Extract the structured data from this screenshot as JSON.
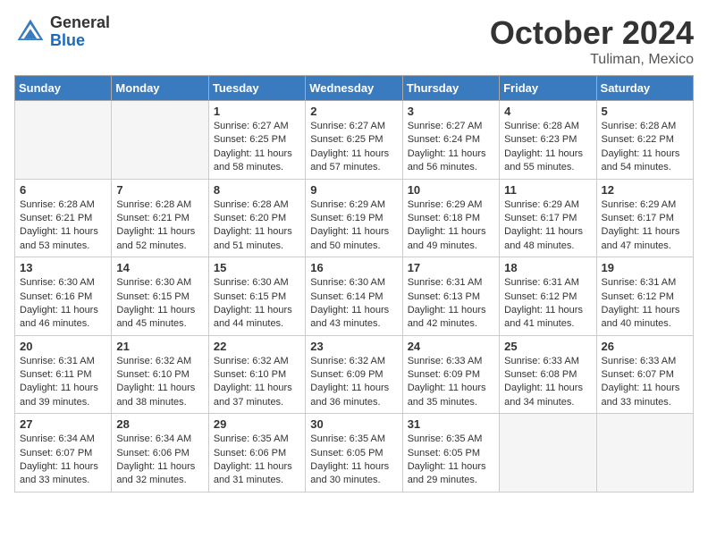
{
  "header": {
    "logo_general": "General",
    "logo_blue": "Blue",
    "month_title": "October 2024",
    "location": "Tuliman, Mexico"
  },
  "weekdays": [
    "Sunday",
    "Monday",
    "Tuesday",
    "Wednesday",
    "Thursday",
    "Friday",
    "Saturday"
  ],
  "weeks": [
    [
      {
        "day": "",
        "empty": true
      },
      {
        "day": "",
        "empty": true
      },
      {
        "day": "1",
        "sunrise": "6:27 AM",
        "sunset": "6:25 PM",
        "daylight": "Daylight: 11 hours and 58 minutes."
      },
      {
        "day": "2",
        "sunrise": "6:27 AM",
        "sunset": "6:25 PM",
        "daylight": "Daylight: 11 hours and 57 minutes."
      },
      {
        "day": "3",
        "sunrise": "6:27 AM",
        "sunset": "6:24 PM",
        "daylight": "Daylight: 11 hours and 56 minutes."
      },
      {
        "day": "4",
        "sunrise": "6:28 AM",
        "sunset": "6:23 PM",
        "daylight": "Daylight: 11 hours and 55 minutes."
      },
      {
        "day": "5",
        "sunrise": "6:28 AM",
        "sunset": "6:22 PM",
        "daylight": "Daylight: 11 hours and 54 minutes."
      }
    ],
    [
      {
        "day": "6",
        "sunrise": "6:28 AM",
        "sunset": "6:21 PM",
        "daylight": "Daylight: 11 hours and 53 minutes."
      },
      {
        "day": "7",
        "sunrise": "6:28 AM",
        "sunset": "6:21 PM",
        "daylight": "Daylight: 11 hours and 52 minutes."
      },
      {
        "day": "8",
        "sunrise": "6:28 AM",
        "sunset": "6:20 PM",
        "daylight": "Daylight: 11 hours and 51 minutes."
      },
      {
        "day": "9",
        "sunrise": "6:29 AM",
        "sunset": "6:19 PM",
        "daylight": "Daylight: 11 hours and 50 minutes."
      },
      {
        "day": "10",
        "sunrise": "6:29 AM",
        "sunset": "6:18 PM",
        "daylight": "Daylight: 11 hours and 49 minutes."
      },
      {
        "day": "11",
        "sunrise": "6:29 AM",
        "sunset": "6:17 PM",
        "daylight": "Daylight: 11 hours and 48 minutes."
      },
      {
        "day": "12",
        "sunrise": "6:29 AM",
        "sunset": "6:17 PM",
        "daylight": "Daylight: 11 hours and 47 minutes."
      }
    ],
    [
      {
        "day": "13",
        "sunrise": "6:30 AM",
        "sunset": "6:16 PM",
        "daylight": "Daylight: 11 hours and 46 minutes."
      },
      {
        "day": "14",
        "sunrise": "6:30 AM",
        "sunset": "6:15 PM",
        "daylight": "Daylight: 11 hours and 45 minutes."
      },
      {
        "day": "15",
        "sunrise": "6:30 AM",
        "sunset": "6:15 PM",
        "daylight": "Daylight: 11 hours and 44 minutes."
      },
      {
        "day": "16",
        "sunrise": "6:30 AM",
        "sunset": "6:14 PM",
        "daylight": "Daylight: 11 hours and 43 minutes."
      },
      {
        "day": "17",
        "sunrise": "6:31 AM",
        "sunset": "6:13 PM",
        "daylight": "Daylight: 11 hours and 42 minutes."
      },
      {
        "day": "18",
        "sunrise": "6:31 AM",
        "sunset": "6:12 PM",
        "daylight": "Daylight: 11 hours and 41 minutes."
      },
      {
        "day": "19",
        "sunrise": "6:31 AM",
        "sunset": "6:12 PM",
        "daylight": "Daylight: 11 hours and 40 minutes."
      }
    ],
    [
      {
        "day": "20",
        "sunrise": "6:31 AM",
        "sunset": "6:11 PM",
        "daylight": "Daylight: 11 hours and 39 minutes."
      },
      {
        "day": "21",
        "sunrise": "6:32 AM",
        "sunset": "6:10 PM",
        "daylight": "Daylight: 11 hours and 38 minutes."
      },
      {
        "day": "22",
        "sunrise": "6:32 AM",
        "sunset": "6:10 PM",
        "daylight": "Daylight: 11 hours and 37 minutes."
      },
      {
        "day": "23",
        "sunrise": "6:32 AM",
        "sunset": "6:09 PM",
        "daylight": "Daylight: 11 hours and 36 minutes."
      },
      {
        "day": "24",
        "sunrise": "6:33 AM",
        "sunset": "6:09 PM",
        "daylight": "Daylight: 11 hours and 35 minutes."
      },
      {
        "day": "25",
        "sunrise": "6:33 AM",
        "sunset": "6:08 PM",
        "daylight": "Daylight: 11 hours and 34 minutes."
      },
      {
        "day": "26",
        "sunrise": "6:33 AM",
        "sunset": "6:07 PM",
        "daylight": "Daylight: 11 hours and 33 minutes."
      }
    ],
    [
      {
        "day": "27",
        "sunrise": "6:34 AM",
        "sunset": "6:07 PM",
        "daylight": "Daylight: 11 hours and 33 minutes."
      },
      {
        "day": "28",
        "sunrise": "6:34 AM",
        "sunset": "6:06 PM",
        "daylight": "Daylight: 11 hours and 32 minutes."
      },
      {
        "day": "29",
        "sunrise": "6:35 AM",
        "sunset": "6:06 PM",
        "daylight": "Daylight: 11 hours and 31 minutes."
      },
      {
        "day": "30",
        "sunrise": "6:35 AM",
        "sunset": "6:05 PM",
        "daylight": "Daylight: 11 hours and 30 minutes."
      },
      {
        "day": "31",
        "sunrise": "6:35 AM",
        "sunset": "6:05 PM",
        "daylight": "Daylight: 11 hours and 29 minutes."
      },
      {
        "day": "",
        "empty": true
      },
      {
        "day": "",
        "empty": true
      }
    ]
  ]
}
